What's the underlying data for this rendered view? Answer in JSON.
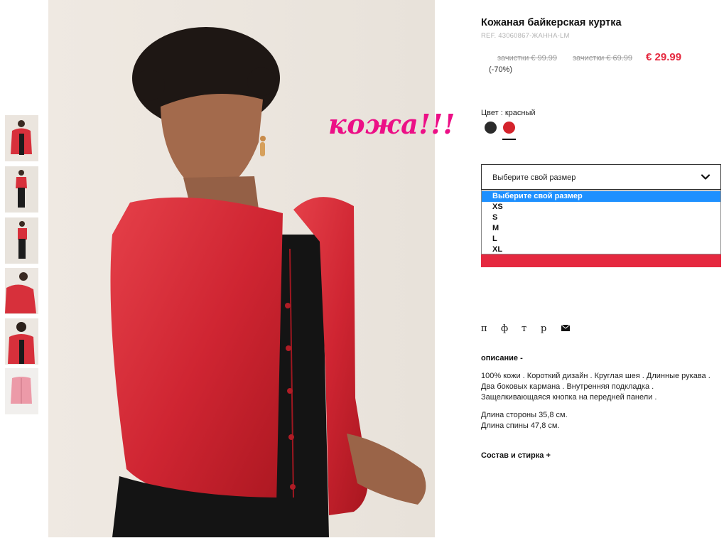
{
  "thumbnails": [
    {
      "icon": "model-front-thumb"
    },
    {
      "icon": "model-full-thumb"
    },
    {
      "icon": "model-full-side-thumb"
    },
    {
      "icon": "jacket-detail-thumb"
    },
    {
      "icon": "model-closeup-thumb"
    },
    {
      "icon": "jacket-flat-thumb"
    }
  ],
  "annotation": "кожа!!!",
  "product": {
    "title": "Кожаная байкерская куртка",
    "ref": "REF. 43060867-ЖАННА-LM",
    "price_old_1": "зачистки € 99.99",
    "price_old_2": "зачистки € 69.99",
    "price_new": "€ 29.99",
    "discount": "(-70%)"
  },
  "color": {
    "label": "Цвет :",
    "value": "красный",
    "swatches": [
      {
        "name": "black",
        "hex": "#2b2b2b"
      },
      {
        "name": "red",
        "hex": "#d4232c"
      }
    ]
  },
  "size": {
    "placeholder": "Выберите свой размер",
    "options": [
      "Выберите свой размер",
      "XS",
      "S",
      "M",
      "L",
      "XL"
    ],
    "selected_index": 0
  },
  "add_button": {
    "label": ""
  },
  "share": {
    "items": [
      "п",
      "ф",
      "т",
      "р"
    ],
    "mail_icon": "envelope-icon"
  },
  "description": {
    "heading": "описание -",
    "text": "100% кожи . Короткий дизайн . Круглая шея . Длинные рукава . Два боковых кармана . Внутренняя подкладка . Защелкивающаяся кнопка на передней панели .",
    "length_side": "Длина стороны 35,8 см.",
    "length_back": "Длина спины 47,8 см."
  },
  "composition": {
    "heading": "Состав и стирка +"
  },
  "colors": {
    "accent": "#e5283f",
    "annotation": "#ec0f86",
    "dropdown_highlight": "#1e90ff"
  }
}
